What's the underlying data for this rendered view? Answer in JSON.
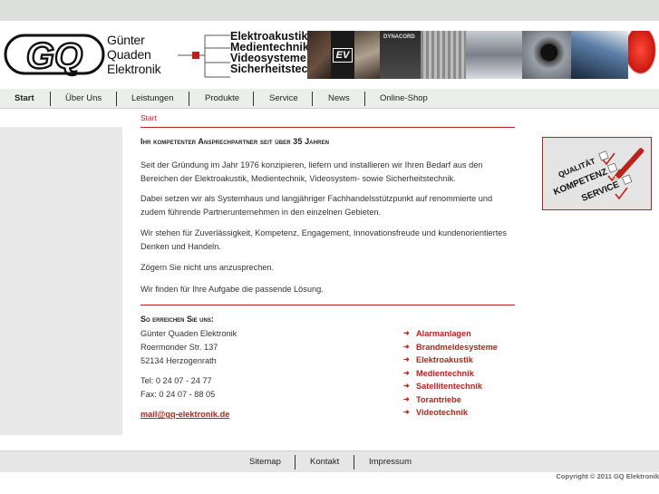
{
  "colors": {
    "accent": "#b8231e",
    "topbar": "#dcdfdc",
    "nav_bg": "#eceeec",
    "side_bg": "#e8e8e8"
  },
  "brand": {
    "logo_letters": "GQ",
    "name_lines": [
      "Günter",
      "Quaden",
      "Elektronik"
    ],
    "business_lines": [
      "Elektroakustik",
      "Medientechnik",
      "Videosysteme",
      "Sicherheitstechnik"
    ]
  },
  "banner": {
    "ev_label": "EV",
    "dynacord_label": "DYNACORD"
  },
  "nav": {
    "items": [
      "Start",
      "Über Uns",
      "Leistungen",
      "Produkte",
      "Service",
      "News",
      "Online-Shop"
    ],
    "active": "Start"
  },
  "breadcrumb": "Start",
  "main": {
    "heading": "Ihr kompetenter Ansprechpartner seit über 35 Jahren",
    "paragraphs": [
      [
        "Seit der Gründung im Jahr 1976 konzipieren, liefern und installieren wir Ihren Bedarf aus den",
        "Bereichen der Elektroakustik, Medientechnik, Videosystem- sowie Sicherheitstechnik."
      ],
      [
        "Dabei setzen wir als Systemhaus und langjähriger Fachhandelsstützpunkt auf renommierte und",
        "zudem führende Partnerunternehmen in den einzelnen Gebieten."
      ],
      [
        "Wir stehen für Zuverlässigkeit, Kompetenz, Engagement, Innovationsfreude und kundenorientiertes",
        "Denken und Handeln."
      ],
      [
        "Zögern Sie nicht uns anzusprechen."
      ],
      [
        "Wir finden für Ihre Aufgabe die passende Lösung."
      ]
    ]
  },
  "contact": {
    "heading": "So erreichen Sie uns:",
    "company": "Günter Quaden Elektronik",
    "street": "Roermonder Str. 137",
    "city": "52134 Herzogenrath",
    "tel": "Tel: 0 24 07 - 24 77",
    "fax": "Fax: 0 24 07 - 88 05",
    "email": "mail@gq-elektronik.de"
  },
  "category_links": [
    "Alarmanlagen",
    "Brandmeldesysteme",
    "Elektroakustik",
    "Medientechnik",
    "Satellitentechnik",
    "Torantriebe",
    "Videotechnik"
  ],
  "badge": {
    "words": [
      "QUALITÄT",
      "KOMPETENZ",
      "SERVICE"
    ]
  },
  "footer": {
    "items": [
      "Sitemap",
      "Kontakt",
      "Impressum"
    ],
    "copyright": "Copyright © 2011 GQ Elektronik"
  }
}
